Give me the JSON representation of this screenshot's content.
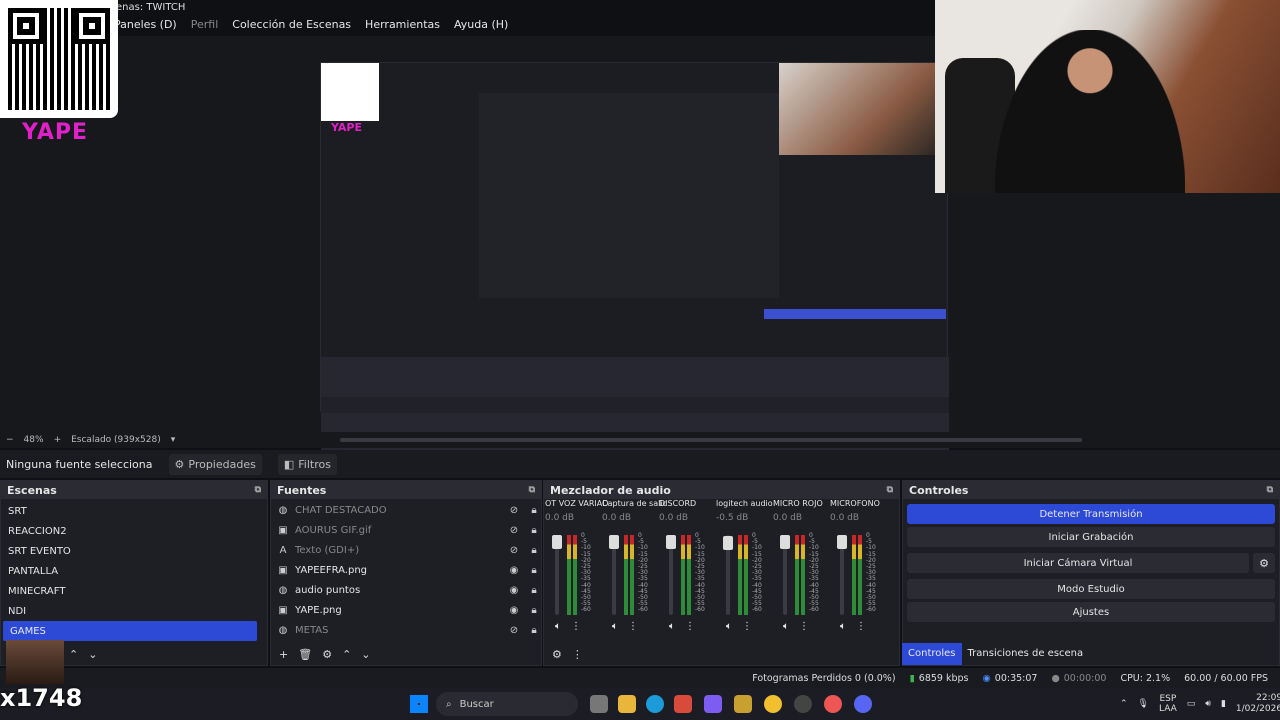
{
  "window_title": "enas: TWITCH",
  "menu": [
    "Paneles (D)",
    "Perfil",
    "Colección de Escenas",
    "Herramientas",
    "Ayuda (H)"
  ],
  "overlay": {
    "yape": "YAPE",
    "stream_tag": "x1748"
  },
  "zoom": {
    "minus": "−",
    "value": "48%",
    "plus": "+",
    "scale": "Escalado (939x528)"
  },
  "source_toolbar": {
    "none": "Ninguna fuente selecciona",
    "props": "Propiedades",
    "filters": "Filtros"
  },
  "scenes": {
    "title": "Escenas",
    "items": [
      "SRT",
      "REACCION2",
      "SRT EVENTO",
      "PANTALLA",
      "MINECRAFT",
      "NDI",
      "GAMES"
    ],
    "selected": "GAMES"
  },
  "sources": {
    "title": "Fuentes",
    "items": [
      {
        "name": "CHAT DESTACADO",
        "visible": false
      },
      {
        "name": "AOURUS GIF.gif",
        "visible": false
      },
      {
        "name": "Texto (GDI+)",
        "visible": false
      },
      {
        "name": "YAPEEFRA.png",
        "visible": true
      },
      {
        "name": "audio puntos",
        "visible": true
      },
      {
        "name": "YAPE.png",
        "visible": true
      },
      {
        "name": "METAS",
        "visible": false
      }
    ]
  },
  "mixer": {
    "title": "Mezclador de audio",
    "channels": [
      {
        "name": "OT VOZ VARIADO",
        "db": "0.0 dB",
        "level": 1.0
      },
      {
        "name": "Captura de salida d",
        "db": "0.0 dB",
        "level": 1.0
      },
      {
        "name": "DISCORD",
        "db": "0.0 dB",
        "level": 1.0
      },
      {
        "name": "logitech audio",
        "db": "-0.5 dB",
        "level": 0.98
      },
      {
        "name": "MICRO ROJO",
        "db": "0.0 dB",
        "level": 1.0
      },
      {
        "name": "MICROFONO",
        "db": "0.0 dB",
        "level": 1.0
      }
    ],
    "scale": [
      "0",
      "-5",
      "-10",
      "-15",
      "-20",
      "-25",
      "-30",
      "-35",
      "-40",
      "-45",
      "-50",
      "-55",
      "-60"
    ]
  },
  "controls": {
    "title": "Controles",
    "stop_stream": "Detener Transmisión",
    "start_record": "Iniciar Grabación",
    "virtual_cam": "Iniciar Cámara Virtual",
    "studio": "Modo Estudio",
    "settings": "Ajustes",
    "tab_controls": "Controles",
    "tab_transitions": "Transiciones de escena"
  },
  "status": {
    "dropped": "Fotogramas Perdidos 0 (0.0%)",
    "bitrate": "6859 kbps",
    "stream_time": "00:35:07",
    "rec_time": "00:00:00",
    "cpu": "CPU: 2.1%",
    "fps": "60.00 / 60.00 FPS"
  },
  "taskbar": {
    "search": "Buscar",
    "lang1": "ESP",
    "lang2": "LAA",
    "time": "22:09",
    "date": "1/02/2026"
  },
  "colors": {
    "accent": "#2d4ad7",
    "bg": "#1e1f25"
  }
}
